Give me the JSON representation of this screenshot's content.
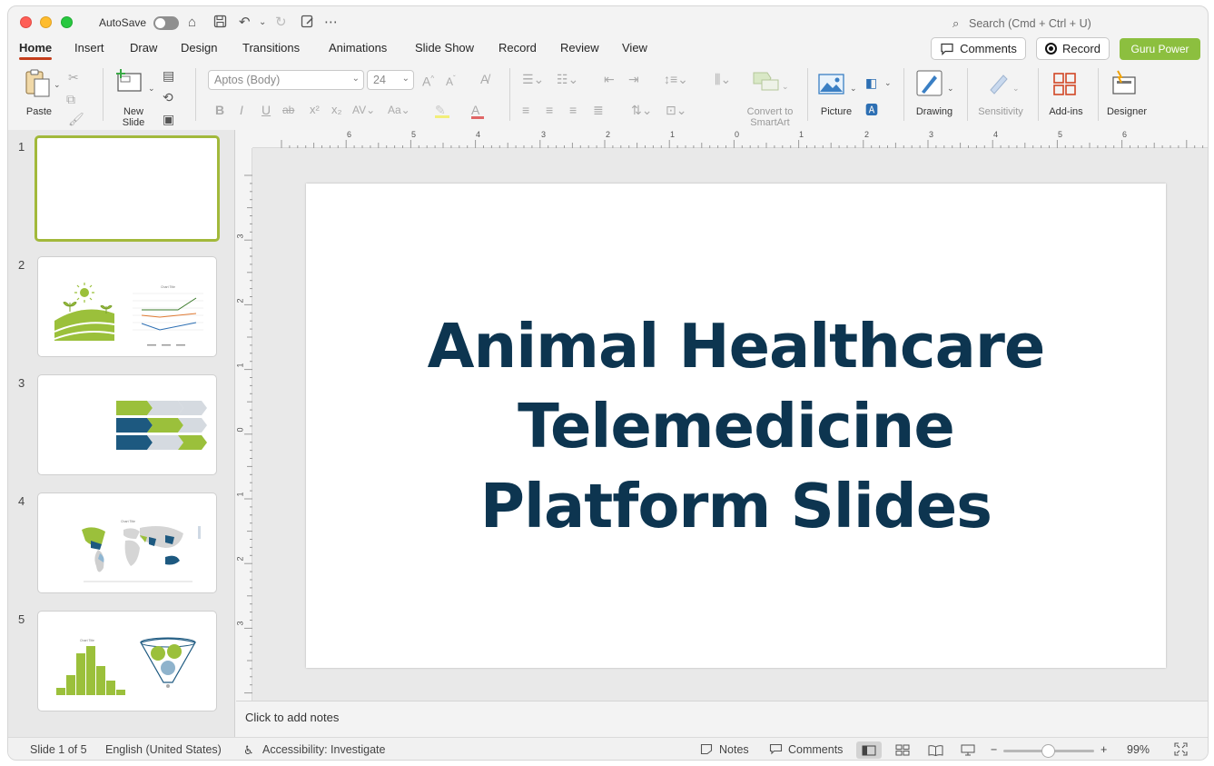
{
  "titlebar": {
    "autosave_label": "AutoSave",
    "search_placeholder": "Search (Cmd + Ctrl + U)"
  },
  "tabs": [
    "Home",
    "Insert",
    "Draw",
    "Design",
    "Transitions",
    "Animations",
    "Slide Show",
    "Record",
    "Review",
    "View"
  ],
  "header_buttons": {
    "comments": "Comments",
    "record": "Record",
    "guru": "Guru Power"
  },
  "colors": {
    "accent_red": "#c43e1c",
    "guru_green": "#8cbf3f",
    "title_navy": "#0d3550",
    "thumb_select": "#a2b93b"
  },
  "ribbon": {
    "paste": "Paste",
    "new_slide_line1": "New",
    "new_slide_line2": "Slide",
    "font_name": "Aptos (Body)",
    "font_size": "24",
    "convert_line1": "Convert to",
    "convert_line2": "SmartArt",
    "picture": "Picture",
    "drawing": "Drawing",
    "sensitivity": "Sensitivity",
    "addins": "Add-ins",
    "designer": "Designer"
  },
  "ruler": {
    "h_ticks": [
      "6",
      "5",
      "4",
      "3",
      "2",
      "1",
      "0",
      "1",
      "2",
      "3",
      "4",
      "5",
      "6"
    ],
    "v_ticks": [
      "3",
      "2",
      "1",
      "0",
      "1",
      "2",
      "3"
    ]
  },
  "thumbnails": [
    {
      "number": "1"
    },
    {
      "number": "2",
      "chart_title": "Chart Title"
    },
    {
      "number": "3"
    },
    {
      "number": "4",
      "chart_title": "Chart Title"
    },
    {
      "number": "5",
      "chart_title": "Chart Title"
    }
  ],
  "slide": {
    "title_line1": "Animal Healthcare",
    "title_line2": "Telemedicine",
    "title_line3": "Platform Slides"
  },
  "notes_placeholder": "Click to add notes",
  "status": {
    "slide_counter": "Slide 1 of 5",
    "language": "English (United States)",
    "accessibility": "Accessibility: Investigate",
    "notes": "Notes",
    "comments": "Comments",
    "zoom_minus": "−",
    "zoom_plus": "+",
    "zoom_level": "99%"
  }
}
